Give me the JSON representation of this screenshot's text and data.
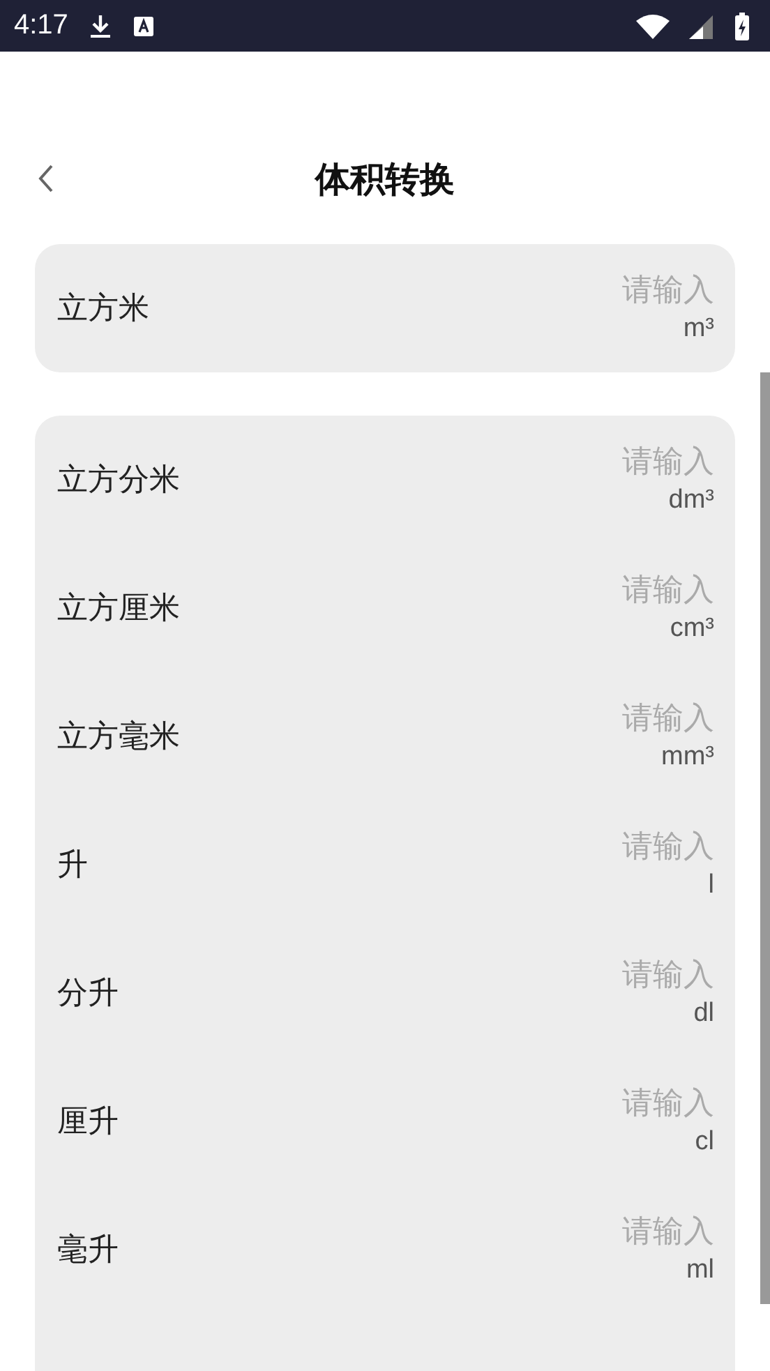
{
  "status_bar": {
    "time": "4:17"
  },
  "header": {
    "title": "体积转换"
  },
  "primary": {
    "label": "立方米",
    "placeholder": "请输入",
    "unit": "m³"
  },
  "units": [
    {
      "label": "立方分米",
      "placeholder": "请输入",
      "unit": "dm³"
    },
    {
      "label": "立方厘米",
      "placeholder": "请输入",
      "unit": "cm³"
    },
    {
      "label": "立方毫米",
      "placeholder": "请输入",
      "unit": "mm³"
    },
    {
      "label": "升",
      "placeholder": "请输入",
      "unit": "l"
    },
    {
      "label": "分升",
      "placeholder": "请输入",
      "unit": "dl"
    },
    {
      "label": "厘升",
      "placeholder": "请输入",
      "unit": "cl"
    },
    {
      "label": "毫升",
      "placeholder": "请输入",
      "unit": "ml"
    }
  ]
}
